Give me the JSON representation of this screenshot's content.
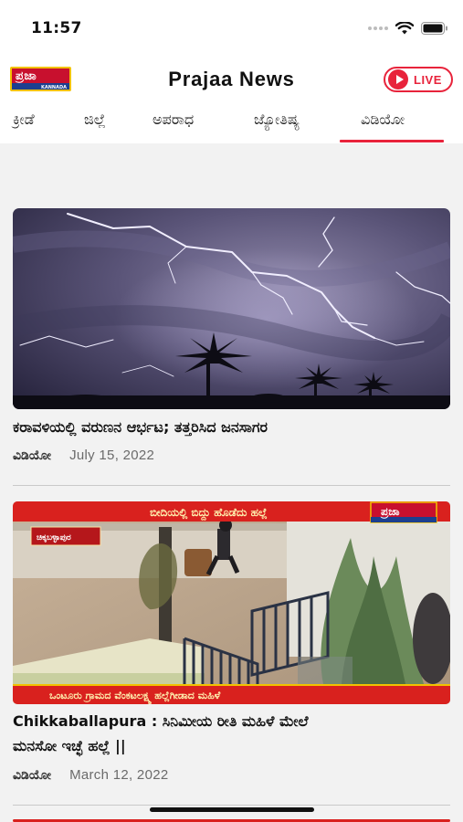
{
  "status_bar": {
    "time": "11:57"
  },
  "header": {
    "logo_text": "ಪ್ರಜಾ",
    "logo_subtext": "KANNADA",
    "title": "Prajaa News",
    "live_label": "LIVE"
  },
  "tabs": [
    {
      "label": "ಕ್ರೀಡೆ",
      "active": false
    },
    {
      "label": "ಜಿಲ್ಲೆ",
      "active": false
    },
    {
      "label": "ಅಪರಾಧ",
      "active": false
    },
    {
      "label": "ಜ್ಯೋತಿಷ್ಯ",
      "active": false
    },
    {
      "label": "ವಿಡಿಯೋ",
      "active": true
    }
  ],
  "articles": [
    {
      "title": "ಕರಾವಳಿಯಲ್ಲಿ ವರುಣನ ಆರ್ಭಟ; ತತ್ತರಿಸಿದ ಜನಸಾಗರ",
      "category": "ವಿಡಿಯೋ",
      "date": "July 15, 2022",
      "thumbnail": "lightning-storm-night-sky"
    },
    {
      "title_line1": "Chikkaballapura : ಸಿನಿಮೀಯ ರೀತಿ ಮಹಿಳೆ ಮೇಲೆ",
      "title_line2": "ಮನಸೋ ಇಚ್ಛೆ ಹಲ್ಲೆ ||",
      "category": "ವಿಡಿಯೋ",
      "date": "March 12, 2022",
      "thumbnail": "cctv-courtyard-footage",
      "banner_top": "ಬೀದಿಯಲ್ಲಿ ಬಿದ್ದು ಹೊಡೆದು ಹಲ್ಲೆ",
      "location_tag": "ಚಿಕ್ಕಬಳ್ಳಾಪುರ",
      "ticker": "ಒಂಟೂರು ಗ್ರಾಮದ ವೆಂಕಟಲಕ್ಷ್ಮ ಹಲ್ಲೆಗೀಡಾದ ಮಹಿಳೆ",
      "channel_logo": "ಪ್ರಜಾ"
    }
  ],
  "colors": {
    "accent": "#e8233b",
    "background": "#f2f2f2"
  }
}
